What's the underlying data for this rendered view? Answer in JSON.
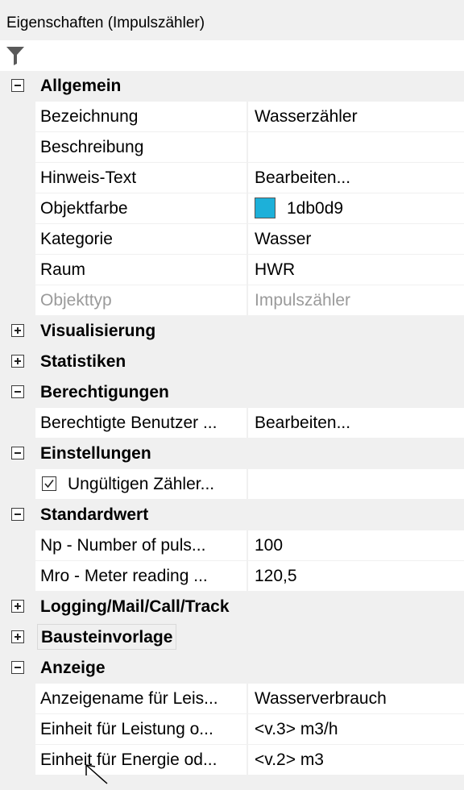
{
  "panel": {
    "title": "Eigenschaften (Impulszähler)"
  },
  "icons": {
    "filter": "filter-funnel-icon",
    "expand": "plus-box-icon",
    "collapse": "minus-box-icon",
    "check": "checkmark-icon"
  },
  "colors": {
    "object_color": "#1db0d9"
  },
  "categories": {
    "allgemein": {
      "label": "Allgemein",
      "props": {
        "bezeichnung": {
          "name": "Bezeichnung",
          "value": "Wasserzähler"
        },
        "beschreibung": {
          "name": "Beschreibung",
          "value": ""
        },
        "hinweis": {
          "name": "Hinweis-Text",
          "value": "Bearbeiten..."
        },
        "objektfarbe": {
          "name": "Objektfarbe",
          "value": "1db0d9"
        },
        "kategorie": {
          "name": "Kategorie",
          "value": "Wasser"
        },
        "raum": {
          "name": "Raum",
          "value": "HWR"
        },
        "objekttyp": {
          "name": "Objekttyp",
          "value": "Impulszähler"
        }
      }
    },
    "visualisierung": {
      "label": "Visualisierung"
    },
    "statistiken": {
      "label": "Statistiken"
    },
    "berechtigungen": {
      "label": "Berechtigungen",
      "props": {
        "benutzer": {
          "name": "Berechtigte Benutzer ...",
          "value": "Bearbeiten..."
        }
      }
    },
    "einstellungen": {
      "label": "Einstellungen",
      "props": {
        "ungueltig": {
          "name": "Ungültigen Zähler...",
          "value": "",
          "checked": true
        }
      }
    },
    "standardwert": {
      "label": "Standardwert",
      "props": {
        "np": {
          "name": "Np - Number of puls...",
          "value": "100"
        },
        "mro": {
          "name": "Mro - Meter reading ...",
          "value": "120,5"
        }
      }
    },
    "logging": {
      "label": "Logging/Mail/Call/Track"
    },
    "bausteinvorlage": {
      "label": "Bausteinvorlage"
    },
    "anzeige": {
      "label": "Anzeige",
      "props": {
        "anzeigename": {
          "name": "Anzeigename für Leis...",
          "value": "Wasserverbrauch"
        },
        "einheit_leistung": {
          "name": "Einheit für Leistung o...",
          "value": "<v.3> m3/h"
        },
        "einheit_energie": {
          "name": "Einheit für Energie od...",
          "value": "<v.2> m3"
        }
      }
    }
  }
}
